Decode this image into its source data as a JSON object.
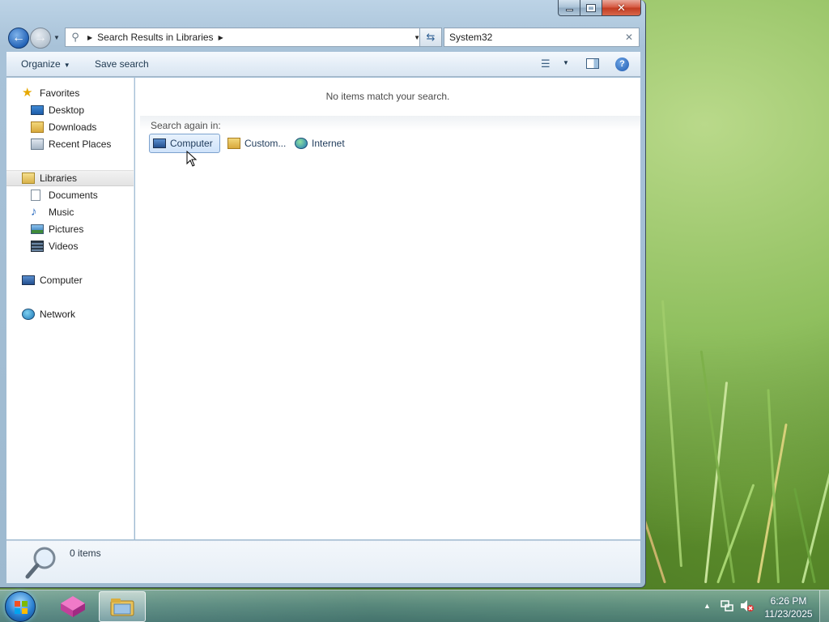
{
  "window": {
    "caption_buttons": {
      "minimize": "minimize-icon",
      "maximize": "maximize-icon",
      "close": "close-icon"
    }
  },
  "nav": {
    "address_path": "Search Results in Libraries",
    "search_value": "System32"
  },
  "toolbar": {
    "organize_label": "Organize",
    "save_search_label": "Save search"
  },
  "sidebar": {
    "favorites": {
      "label": "Favorites",
      "items": [
        {
          "label": "Desktop"
        },
        {
          "label": "Downloads"
        },
        {
          "label": "Recent Places"
        }
      ]
    },
    "libraries": {
      "label": "Libraries",
      "items": [
        {
          "label": "Documents"
        },
        {
          "label": "Music"
        },
        {
          "label": "Pictures"
        },
        {
          "label": "Videos"
        }
      ]
    },
    "computer_label": "Computer",
    "network_label": "Network"
  },
  "content": {
    "empty_message": "No items match your search.",
    "search_again_label": "Search again in:",
    "search_again_options": [
      {
        "label": "Computer"
      },
      {
        "label": "Custom..."
      },
      {
        "label": "Internet"
      }
    ]
  },
  "details": {
    "item_count": "0 items"
  },
  "taskbar": {
    "time": "6:26 PM",
    "date": "11/23/2025"
  },
  "colors": {
    "selection_bg": "#cfe3fa",
    "selection_border": "#7da2ce",
    "toolbar_text": "#1e3850"
  }
}
